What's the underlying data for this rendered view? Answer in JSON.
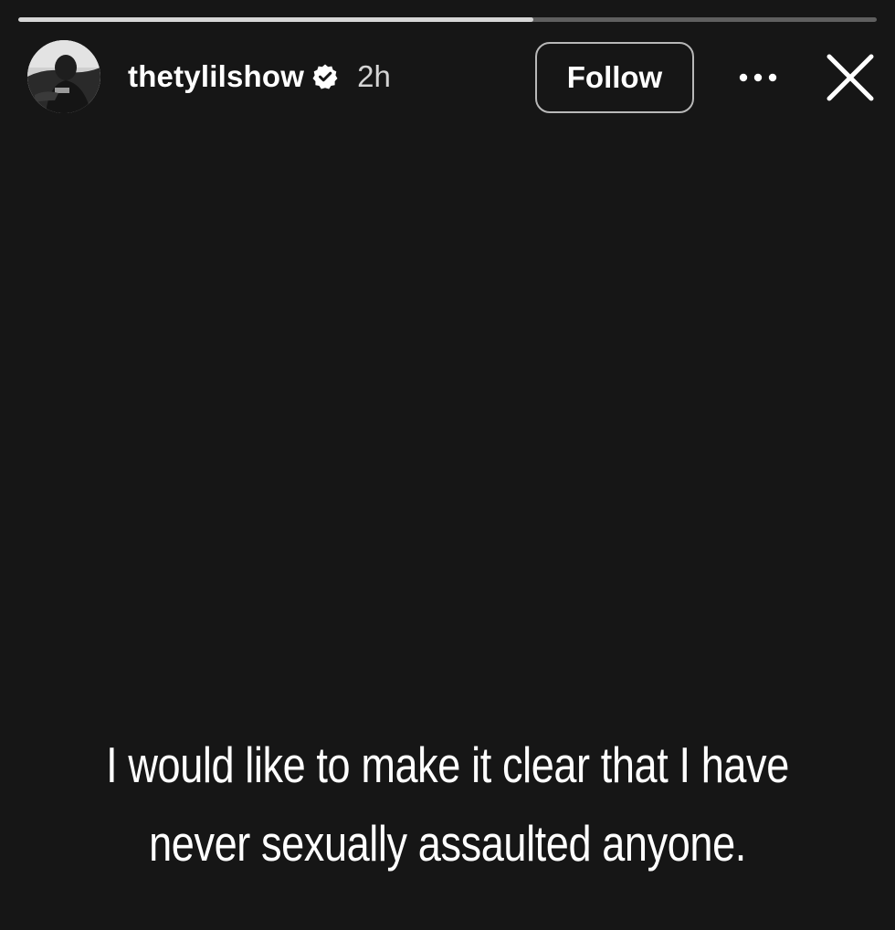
{
  "story": {
    "progress": 0.6,
    "user": {
      "username": "thetylilshow",
      "verified": true,
      "time_ago": "2h"
    },
    "follow_label": "Follow",
    "icons": {
      "avatar": "profile-photo",
      "verified": "verified-badge-icon",
      "more": "more-options-icon",
      "close": "close-icon"
    },
    "caption": "I would like to make it clear that I have never sexually assaulted anyone."
  },
  "colors": {
    "background": "#161616",
    "progress_track": "#5f5f5f",
    "progress_fill": "#d6d6d6",
    "text": "#ffffff",
    "button_border": "#b8b8b8"
  }
}
